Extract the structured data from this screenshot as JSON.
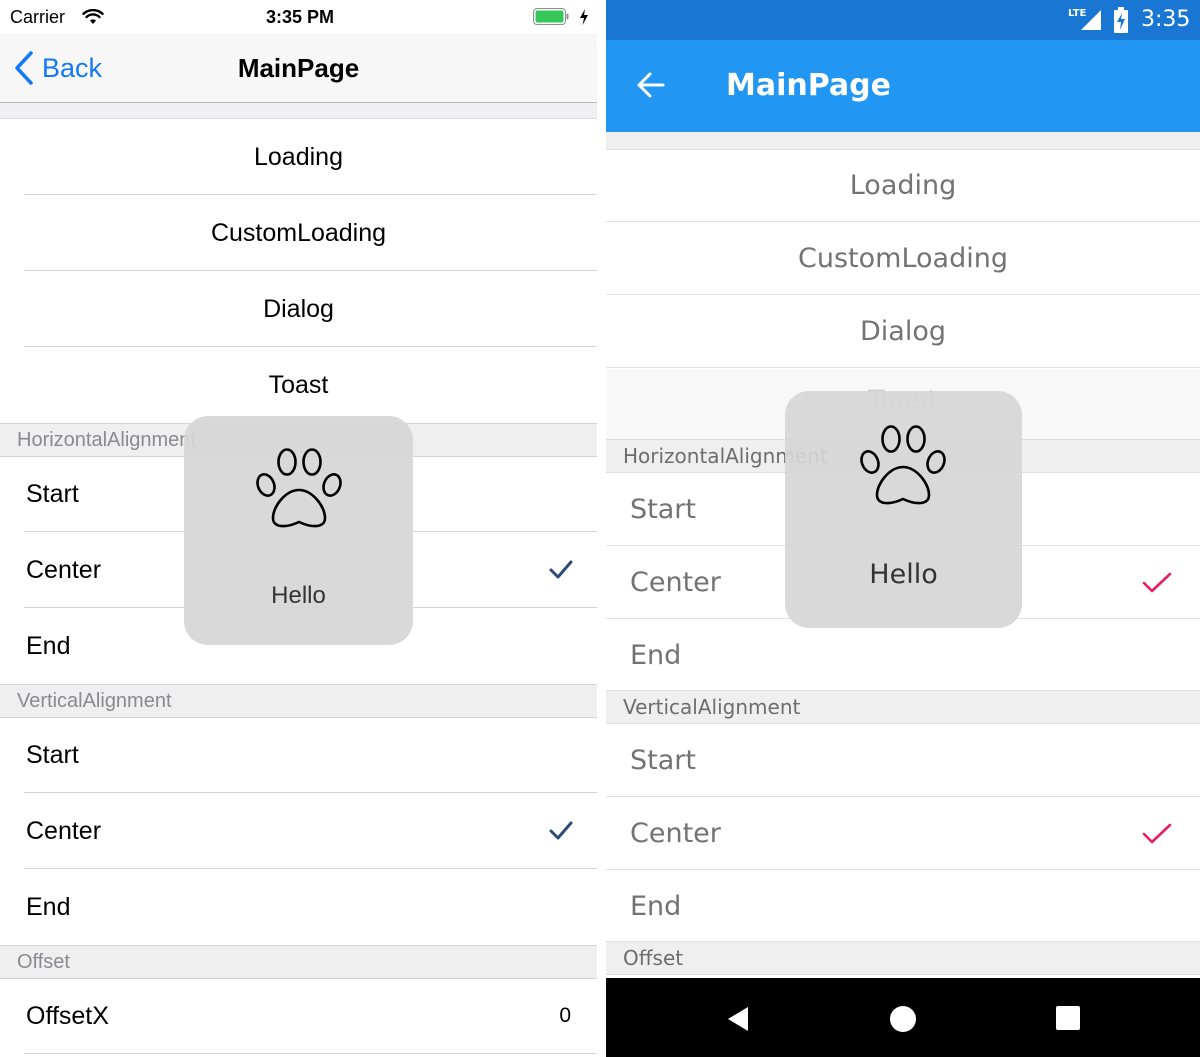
{
  "ios": {
    "status": {
      "carrier": "Carrier",
      "time": "3:35 PM"
    },
    "nav": {
      "back_label": "Back",
      "title": "MainPage"
    },
    "menu_items": [
      {
        "label": "Loading"
      },
      {
        "label": "CustomLoading"
      },
      {
        "label": "Dialog"
      },
      {
        "label": "Toast"
      }
    ],
    "sections": {
      "horizontal": {
        "title": "HorizontalAlignment",
        "options": [
          {
            "label": "Start",
            "selected": false
          },
          {
            "label": "Center",
            "selected": true
          },
          {
            "label": "End",
            "selected": false
          }
        ]
      },
      "vertical": {
        "title": "VerticalAlignment",
        "options": [
          {
            "label": "Start",
            "selected": false
          },
          {
            "label": "Center",
            "selected": true
          },
          {
            "label": "End",
            "selected": false
          }
        ]
      },
      "offset": {
        "title": "Offset",
        "rows": [
          {
            "label": "OffsetX",
            "value": "0"
          }
        ]
      }
    },
    "toast": {
      "icon": "paw-icon",
      "message": "Hello"
    },
    "colors": {
      "accent": "#1279f7",
      "check": "#2f4a7a"
    }
  },
  "android": {
    "status": {
      "network": "LTE",
      "time": "3:35"
    },
    "toolbar": {
      "title": "MainPage"
    },
    "menu_items": [
      {
        "label": "Loading"
      },
      {
        "label": "CustomLoading"
      },
      {
        "label": "Dialog"
      },
      {
        "label": "Toast"
      }
    ],
    "sections": {
      "horizontal": {
        "title": "HorizontalAlignment",
        "options": [
          {
            "label": "Start",
            "selected": false
          },
          {
            "label": "Center",
            "selected": true
          },
          {
            "label": "End",
            "selected": false
          }
        ]
      },
      "vertical": {
        "title": "VerticalAlignment",
        "options": [
          {
            "label": "Start",
            "selected": false
          },
          {
            "label": "Center",
            "selected": true
          },
          {
            "label": "End",
            "selected": false
          }
        ]
      },
      "offset": {
        "title": "Offset"
      }
    },
    "toast": {
      "icon": "paw-icon",
      "message": "Hello"
    },
    "colors": {
      "primary": "#2196f3",
      "primary_dark": "#1976d2",
      "check": "#e91e63"
    }
  }
}
